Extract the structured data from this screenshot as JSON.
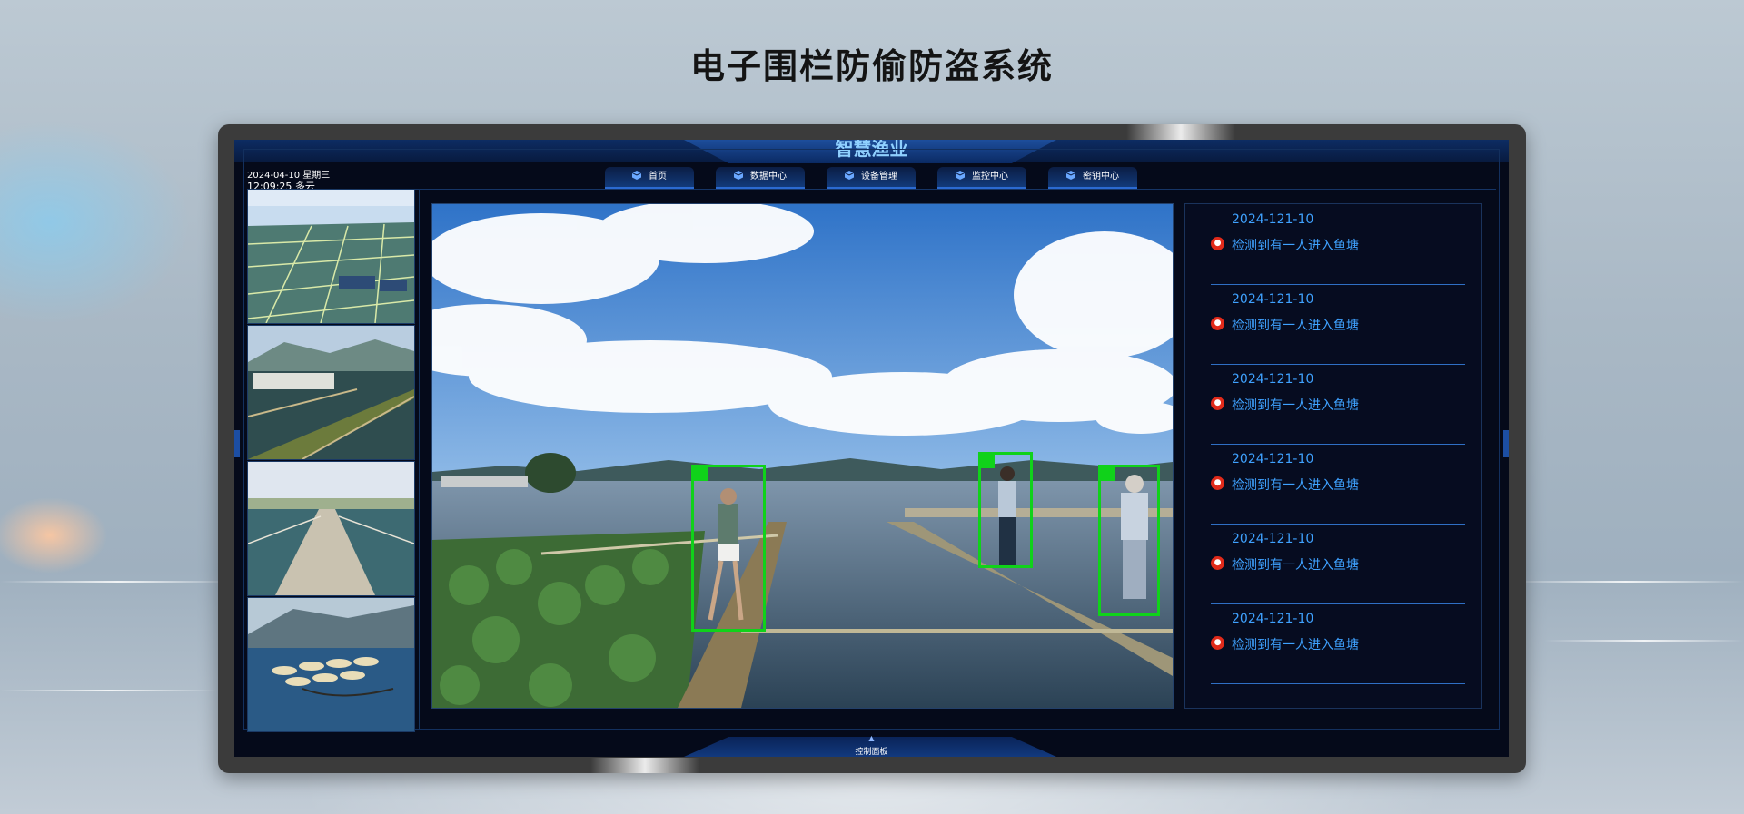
{
  "page": {
    "title": "电子围栏防偷防盗系统"
  },
  "app": {
    "title": "智慧渔业",
    "date": "2024-04-10 星期三",
    "time_weather": "12:09:25 多云",
    "control_panel_label": "控制面板"
  },
  "nav": {
    "items": [
      {
        "label": "首页",
        "icon": "cube-icon"
      },
      {
        "label": "数据中心",
        "icon": "cube-icon"
      },
      {
        "label": "设备管理",
        "icon": "cube-icon"
      },
      {
        "label": "监控中心",
        "icon": "cube-icon"
      },
      {
        "label": "密钥中心",
        "icon": "cube-icon"
      }
    ]
  },
  "alerts": [
    {
      "date": "2024-121-10",
      "message": "检测到有一人进入鱼塘"
    },
    {
      "date": "2024-121-10",
      "message": "检测到有一人进入鱼塘"
    },
    {
      "date": "2024-121-10",
      "message": "检测到有一人进入鱼塘"
    },
    {
      "date": "2024-121-10",
      "message": "检测到有一人进入鱼塘"
    },
    {
      "date": "2024-121-10",
      "message": "检测到有一人进入鱼塘"
    },
    {
      "date": "2024-121-10",
      "message": "检测到有一人进入鱼塘"
    }
  ],
  "colors": {
    "accent": "#3fa2ff",
    "detection": "#10d21a",
    "alert_icon": "#e02a1a",
    "screen_bg": "#050a1a"
  }
}
